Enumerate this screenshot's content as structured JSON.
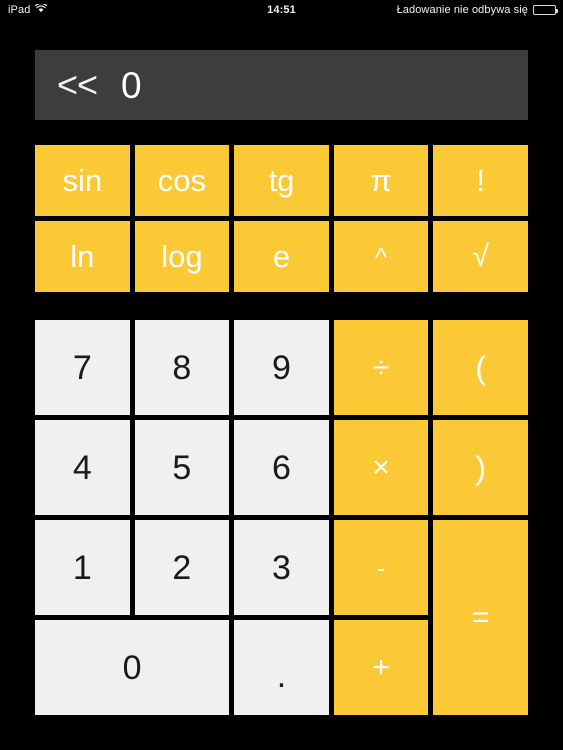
{
  "status_bar": {
    "device_label": "iPad",
    "wifi_icon": "wifi-icon",
    "time": "14:51",
    "battery_text": "Ładowanie nie odbywa się",
    "battery_icon": "battery-icon"
  },
  "display": {
    "backspace_label": "<<",
    "value": "0"
  },
  "colors": {
    "accent_yellow": "#fbc836",
    "digit_key": "#f0f0f0",
    "display_bg": "#3d3d3d",
    "background": "#000000"
  },
  "function_keys": [
    {
      "label": "sin",
      "name": "sin-key"
    },
    {
      "label": "cos",
      "name": "cos-key"
    },
    {
      "label": "tg",
      "name": "tangent-key"
    },
    {
      "label": "π",
      "name": "pi-key"
    },
    {
      "label": "!",
      "name": "factorial-key"
    },
    {
      "label": "ln",
      "name": "natural-log-key"
    },
    {
      "label": "log",
      "name": "log-key"
    },
    {
      "label": "e",
      "name": "euler-key"
    },
    {
      "label": "^",
      "name": "power-key"
    },
    {
      "label": "√",
      "name": "square-root-key"
    }
  ],
  "number_keys": {
    "seven": "7",
    "eight": "8",
    "nine": "9",
    "divide": "÷",
    "open_paren": "(",
    "four": "4",
    "five": "5",
    "six": "6",
    "multiply": "×",
    "close_paren": ")",
    "one": "1",
    "two": "2",
    "three": "3",
    "minus": "-",
    "equals": "=",
    "zero": "0",
    "decimal": ".",
    "plus": "+"
  }
}
